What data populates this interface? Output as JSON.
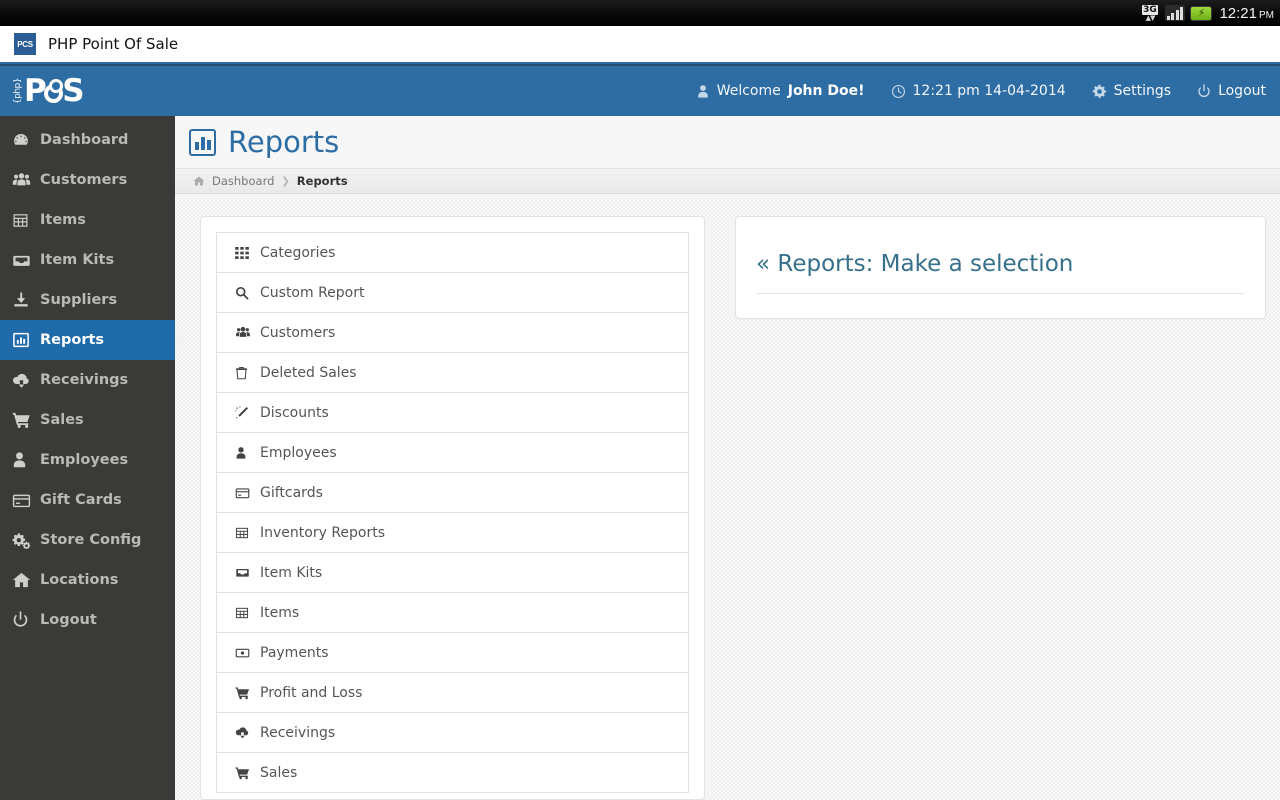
{
  "status_bar": {
    "network_label": "3G",
    "time": "12:21",
    "ampm": "PM",
    "icons": [
      "3g-network-icon",
      "signal-bars-icon",
      "battery-charging-icon"
    ]
  },
  "browser": {
    "favicon_label": "PCS",
    "title": "PHP Point Of Sale"
  },
  "brand": {
    "php_label": "{php}",
    "name_left": "P",
    "name_right": "S"
  },
  "topbar": {
    "welcome_prefix": "Welcome",
    "user_name": "John Doe!",
    "datetime": "12:21 pm 14-04-2014",
    "settings_label": "Settings",
    "logout_label": "Logout"
  },
  "sidebar": {
    "items": [
      {
        "label": "Dashboard",
        "icon": "dashboard-gauge-icon",
        "active": false
      },
      {
        "label": "Customers",
        "icon": "users-group-icon",
        "active": false
      },
      {
        "label": "Items",
        "icon": "table-grid-icon",
        "active": false
      },
      {
        "label": "Item Kits",
        "icon": "inbox-icon",
        "active": false
      },
      {
        "label": "Suppliers",
        "icon": "download-truck-icon",
        "active": false
      },
      {
        "label": "Reports",
        "icon": "bar-chart-icon",
        "active": true
      },
      {
        "label": "Receivings",
        "icon": "cloud-download-icon",
        "active": false
      },
      {
        "label": "Sales",
        "icon": "shopping-cart-icon",
        "active": false
      },
      {
        "label": "Employees",
        "icon": "user-icon",
        "active": false
      },
      {
        "label": "Gift Cards",
        "icon": "credit-card-icon",
        "active": false
      },
      {
        "label": "Store Config",
        "icon": "cogs-icon",
        "active": false
      },
      {
        "label": "Locations",
        "icon": "home-icon",
        "active": false
      },
      {
        "label": "Logout",
        "icon": "power-off-icon",
        "active": false
      }
    ]
  },
  "page": {
    "title": "Reports",
    "title_icon": "bar-chart-boxed-icon"
  },
  "breadcrumb": {
    "home_icon": "home-icon",
    "parent": "Dashboard",
    "separator": "❯",
    "current": "Reports"
  },
  "reports_list": {
    "items": [
      {
        "label": "Categories",
        "icon": "th-grid-icon"
      },
      {
        "label": "Custom Report",
        "icon": "search-icon"
      },
      {
        "label": "Customers",
        "icon": "users-group-icon"
      },
      {
        "label": "Deleted Sales",
        "icon": "trash-icon"
      },
      {
        "label": "Discounts",
        "icon": "magic-wand-icon"
      },
      {
        "label": "Employees",
        "icon": "user-icon"
      },
      {
        "label": "Giftcards",
        "icon": "credit-card-icon"
      },
      {
        "label": "Inventory Reports",
        "icon": "table-icon"
      },
      {
        "label": "Item Kits",
        "icon": "inbox-icon"
      },
      {
        "label": "Items",
        "icon": "table-icon"
      },
      {
        "label": "Payments",
        "icon": "money-bill-icon"
      },
      {
        "label": "Profit and Loss",
        "icon": "shopping-cart-icon"
      },
      {
        "label": "Receivings",
        "icon": "cloud-download-icon"
      },
      {
        "label": "Sales",
        "icon": "shopping-cart-icon"
      }
    ]
  },
  "selection_panel": {
    "title": "« Reports: Make a selection"
  },
  "colors": {
    "header_blue": "#2e6da4",
    "sidebar_dark": "#3a3a38",
    "active_blue": "#1f6aa9",
    "title_blue": "#2e6da4",
    "selection_teal": "#36708a",
    "content_bg": "#f0f0f0"
  }
}
